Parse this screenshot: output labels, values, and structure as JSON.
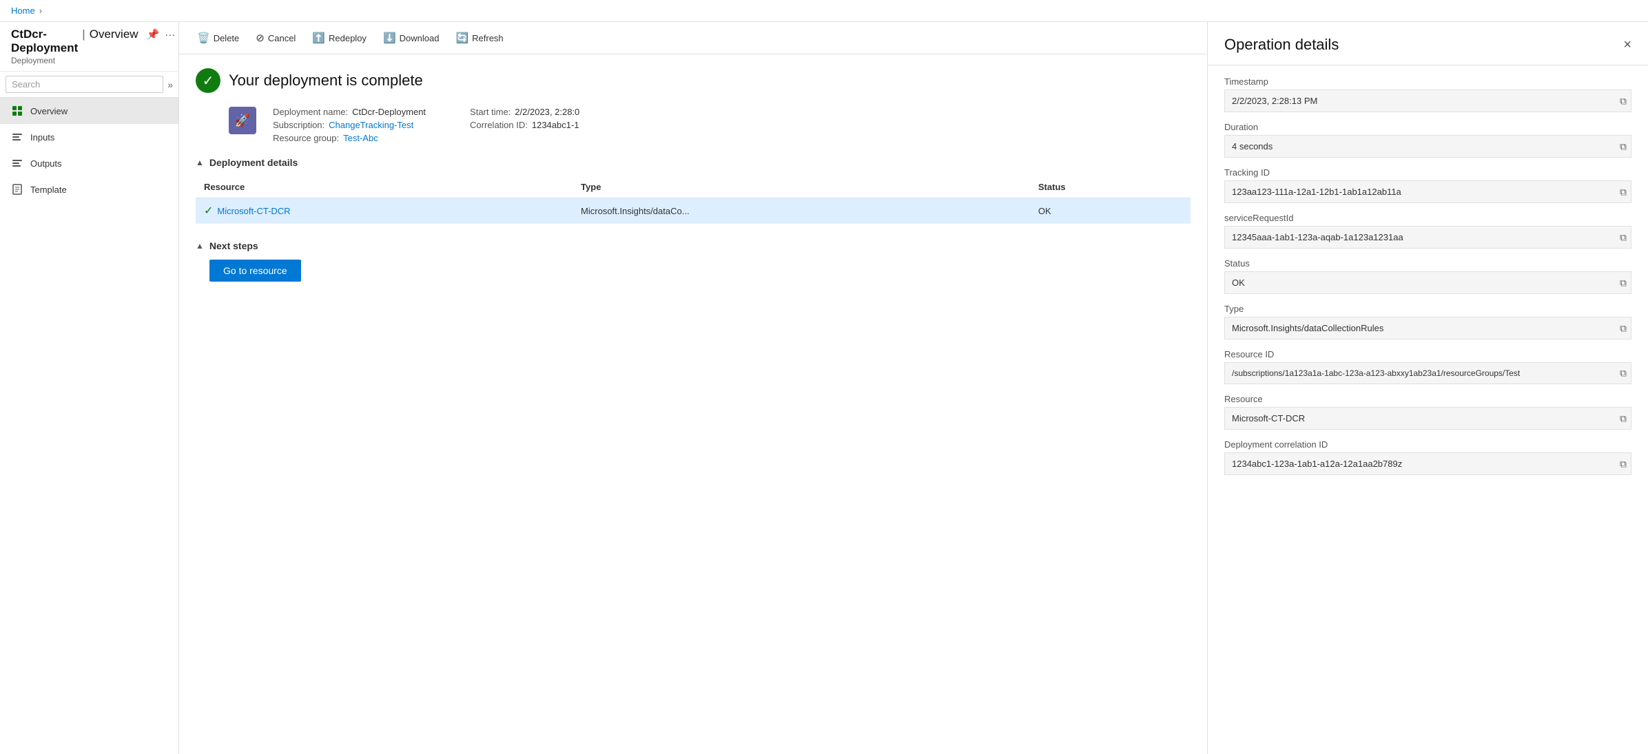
{
  "breadcrumb": {
    "home": "Home"
  },
  "sidebar": {
    "title": "CtDcr-Deployment",
    "pipe": "|",
    "page": "Overview",
    "subtitle": "Deployment",
    "search_placeholder": "Search",
    "nav_items": [
      {
        "id": "overview",
        "label": "Overview",
        "icon": "overview",
        "active": true
      },
      {
        "id": "inputs",
        "label": "Inputs",
        "icon": "inputs",
        "active": false
      },
      {
        "id": "outputs",
        "label": "Outputs",
        "icon": "outputs",
        "active": false
      },
      {
        "id": "template",
        "label": "Template",
        "icon": "template",
        "active": false
      }
    ]
  },
  "toolbar": {
    "delete_label": "Delete",
    "cancel_label": "Cancel",
    "redeploy_label": "Redeploy",
    "download_label": "Download",
    "refresh_label": "Refresh"
  },
  "deployment": {
    "status_title": "Your deployment is complete",
    "meta": {
      "name_label": "Deployment name:",
      "name_value": "CtDcr-Deployment",
      "subscription_label": "Subscription:",
      "subscription_value": "ChangeTracking-Test",
      "resource_group_label": "Resource group:",
      "resource_group_value": "Test-Abc",
      "start_time_label": "Start time:",
      "start_time_value": "2/2/2023, 2:28:0",
      "correlation_label": "Correlation ID:",
      "correlation_value": "1234abc1-1"
    },
    "details_section": "Deployment details",
    "table": {
      "columns": [
        "Resource",
        "Type",
        "Status"
      ],
      "rows": [
        {
          "resource": "Microsoft-CT-DCR",
          "type": "Microsoft.Insights/dataCo...",
          "status": "OK"
        }
      ]
    },
    "next_steps_section": "Next steps",
    "go_to_resource_label": "Go to resource"
  },
  "operation_details": {
    "title": "Operation details",
    "close_label": "×",
    "fields": [
      {
        "id": "timestamp",
        "label": "Timestamp",
        "value": "2/2/2023, 2:28:13 PM"
      },
      {
        "id": "duration",
        "label": "Duration",
        "value": "4 seconds"
      },
      {
        "id": "tracking-id",
        "label": "Tracking ID",
        "value": "123aa123-111a-12a1-12b1-1ab1a12ab11a"
      },
      {
        "id": "service-request-id",
        "label": "serviceRequestId",
        "value": "12345aaa-1ab1-123a-aqab-1a123a1231aa"
      },
      {
        "id": "status",
        "label": "Status",
        "value": "OK"
      },
      {
        "id": "type",
        "label": "Type",
        "value": "Microsoft.Insights/dataCollectionRules"
      },
      {
        "id": "resource-id",
        "label": "Resource ID",
        "value": "/subscriptions/1a123a1a-1abc-123a-a123-abxxy1ab23a1/resourceGroups/Test"
      },
      {
        "id": "resource",
        "label": "Resource",
        "value": "Microsoft-CT-DCR"
      },
      {
        "id": "deployment-correlation-id",
        "label": "Deployment correlation ID",
        "value": "1234abc1-123a-1ab1-a12a-12a1aa2b789z"
      }
    ]
  }
}
